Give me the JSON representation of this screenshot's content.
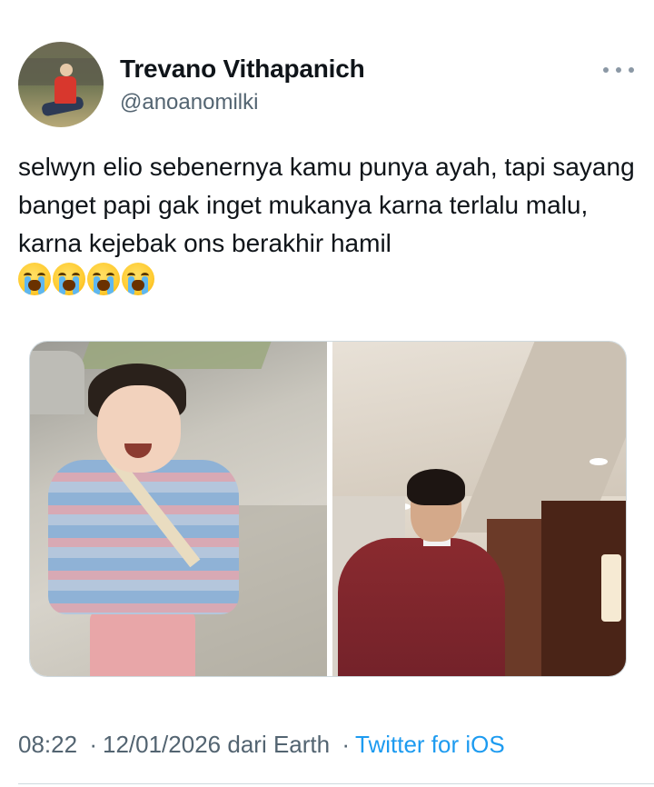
{
  "author": {
    "display_name": "Trevano Vithapanich",
    "handle": "@anoanomilki"
  },
  "tweet": {
    "text": "selwyn elio sebenernya kamu punya ayah, tapi sayang banget papi gak inget mukanya karna terlalu malu, karna kejebak ons berakhir hamil",
    "emojis": [
      "loudly-crying-face",
      "loudly-crying-face",
      "loudly-crying-face",
      "loudly-crying-face"
    ]
  },
  "media": {
    "count": 2,
    "items": [
      "photo-child-running",
      "photo-man-red-suit"
    ]
  },
  "meta": {
    "time": "08:22",
    "date": "12/01/2026",
    "location": "dari Earth",
    "separator": "·",
    "client": "Twitter for iOS"
  },
  "colors": {
    "text": "#0f1419",
    "secondary": "#536471",
    "link": "#1d9bf0",
    "border": "#cfd9de"
  },
  "icons": {
    "more": "more-dots-icon"
  }
}
